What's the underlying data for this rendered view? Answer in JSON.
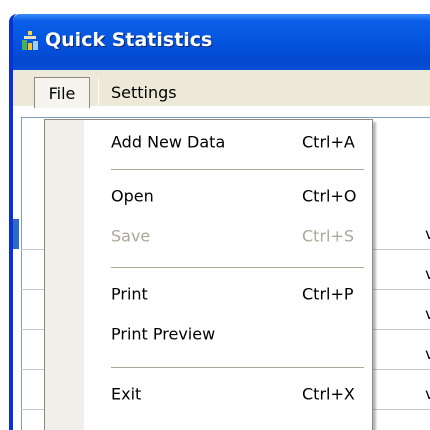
{
  "window": {
    "title": "Quick Statistics",
    "app_icon": "statistics-app-icon"
  },
  "menubar": {
    "items": [
      {
        "label": "File",
        "open": true
      },
      {
        "label": "Settings"
      }
    ]
  },
  "file_menu": {
    "items": [
      {
        "label": "Add New Data",
        "shortcut": "Ctrl+A",
        "enabled": true
      },
      {
        "label": "Open",
        "shortcut": "Ctrl+O",
        "enabled": true
      },
      {
        "label": "Save",
        "shortcut": "Ctrl+S",
        "enabled": false
      },
      {
        "label": "Print",
        "shortcut": "Ctrl+P",
        "enabled": true
      },
      {
        "label": "Print Preview",
        "shortcut": "",
        "enabled": true
      },
      {
        "label": "Exit",
        "shortcut": "Ctrl+X",
        "enabled": true
      }
    ]
  },
  "grid": {
    "partial_cells": [
      "v",
      "v",
      "v",
      "v",
      "v"
    ]
  },
  "colors": {
    "titlebar": "#0452dd",
    "menu_background": "#ece9d8",
    "disabled_text": "#aca899",
    "selection": "#316ac5"
  }
}
